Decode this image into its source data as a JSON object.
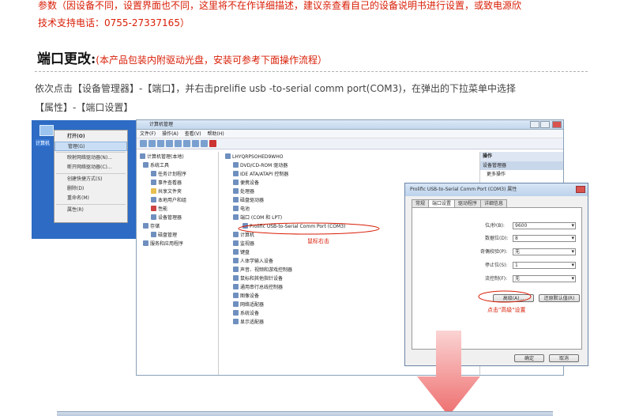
{
  "notes": {
    "line1": "参数（因设备不同，设置界面也不同，这里将不在作详细描述，建议亲查看自己的设备说明书进行设置，或致电源欣",
    "line2": "技术支持电话：0755-27337165）"
  },
  "section": {
    "title": "端口更改:",
    "subtitle": "(本产品包装内附驱动光盘，安装可参考下面操作流程）"
  },
  "instructions": {
    "line1": "依次点击【设备管理器】-【端口】，并右击prelifie usb -to-serial comm port(COM3)，在弹出的下拉菜单中选择",
    "line2": "【属性】-【端口设置】"
  },
  "desktop": {
    "icon_label": "计算机"
  },
  "context_menu": {
    "items": [
      "打开(O)",
      "管理(G)",
      "映射网络驱动器(N)...",
      "断开网络驱动器(C)...",
      "创建快捷方式(S)",
      "删除(D)",
      "重命名(M)",
      "属性(R)"
    ]
  },
  "computer_mgmt": {
    "title": "计算机管理",
    "menu": [
      "文件(F)",
      "操作(A)",
      "查看(V)",
      "帮助(H)"
    ],
    "left_tree": [
      "计算机管理(本地)",
      "系统工具",
      "任务计划程序",
      "事件查看器",
      "共享文件夹",
      "本地用户和组",
      "性能",
      "设备管理器",
      "存储",
      "磁盘管理",
      "服务和应用程序"
    ],
    "device_tree": [
      "LHYQRPSOHED9WHO",
      "DVD/CD-ROM 驱动器",
      "IDE ATA/ATAPI 控制器",
      "便携设备",
      "处理器",
      "磁盘驱动器",
      "电池",
      "端口 (COM 和 LPT)",
      "Prolific USB-to-Serial Comm Port (COM3)",
      "计算机",
      "监视器",
      "键盘",
      "人体学输入设备",
      "声音、视频和游戏控制器",
      "鼠标和其他指针设备",
      "通用串行总线控制器",
      "图像设备",
      "网络适配器",
      "系统设备",
      "显示适配器"
    ],
    "actions_title": "操作",
    "actions": [
      "设备管理器",
      "更多操作"
    ]
  },
  "annotations": {
    "right_click": "鼠标右击",
    "click_advanced": "点击\"高级\"设置"
  },
  "properties_dialog": {
    "title": "Prolific USB-to-Serial Comm Port (COM3) 属性",
    "tabs": [
      "常规",
      "端口设置",
      "驱动程序",
      "详细信息"
    ],
    "active_tab": "端口设置",
    "fields": [
      {
        "label": "位/秒(B):",
        "value": "9600"
      },
      {
        "label": "数据位(D):",
        "value": "8"
      },
      {
        "label": "奇偶校验(P):",
        "value": "无"
      },
      {
        "label": "停止位(S):",
        "value": "1"
      },
      {
        "label": "流控制(F):",
        "value": "无"
      }
    ],
    "advanced_button": "高级(A)...",
    "restore_button": "还原默认值(R)",
    "ok_button": "确定",
    "cancel_button": "取消"
  },
  "colors": {
    "accent_red": "#d81e06",
    "arrow_pink": "#f07b7b"
  }
}
